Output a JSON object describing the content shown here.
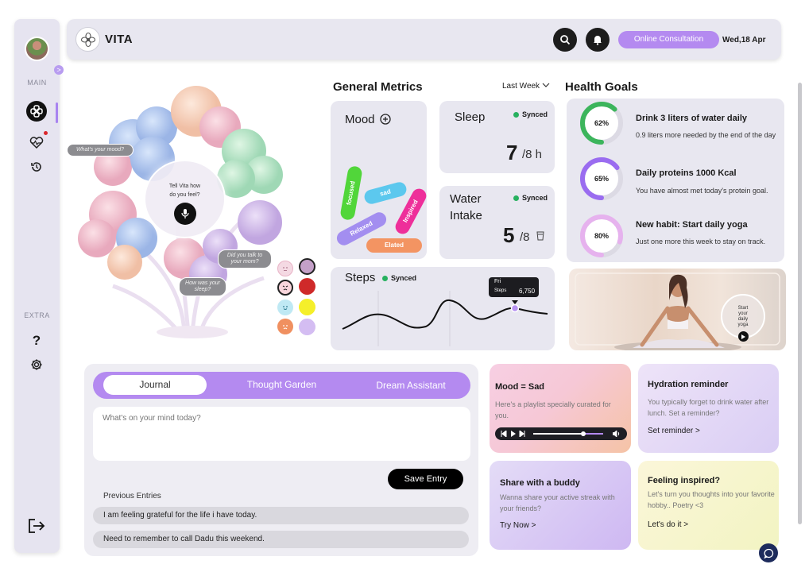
{
  "app": {
    "name": "VITA",
    "date": "Wed,18 Apr",
    "consult_label": "Online Consultation"
  },
  "sidebar": {
    "main_label": "MAIN",
    "extra_label": "EXTRA",
    "expand_icon": ">"
  },
  "hero": {
    "bubble_mood": "What's your mood?",
    "talk_prompt": "Tell Vita how do you feel?",
    "bubble_mom": "Did you talk to your mom?",
    "bubble_sleep": "How was your sleep?"
  },
  "metrics": {
    "title": "General Metrics",
    "period": "Last Week",
    "mood_title": "Mood",
    "mood_tags": [
      "focused",
      "sad",
      "Inspired",
      "Relaxed",
      "Elated"
    ],
    "sleep": {
      "title": "Sleep",
      "status": "Synced",
      "value": "7",
      "unit": "/8 h"
    },
    "water": {
      "title_line1": "Water",
      "title_line2": "Intake",
      "status": "Synced",
      "value": "5",
      "unit": "/8"
    },
    "steps": {
      "title": "Steps",
      "status": "Synced",
      "tooltip_day": "Fri",
      "tooltip_label": "Steps",
      "tooltip_value": "6,750"
    }
  },
  "health_goals": {
    "title": "Health Goals",
    "goals": [
      {
        "percent": "62%",
        "value": 62,
        "title": "Drink 3 liters of water daily",
        "desc": "0.9 liters more needed by the end of the day",
        "color": "#3cb55c"
      },
      {
        "percent": "65%",
        "value": 65,
        "title": "Daily proteins 1000 Kcal",
        "desc": "You have almost met today's protein goal.",
        "color": "#9a6cf0"
      },
      {
        "percent": "80%",
        "value": 80,
        "title": "New habit: Start daily yoga",
        "desc": "Just one more this week to stay on track.",
        "color": "#e6b2ee"
      }
    ],
    "yoga_label": "Start your daily yoga"
  },
  "journal": {
    "tabs": [
      "Journal",
      "Thought Garden",
      "Dream Assistant"
    ],
    "placeholder": "What's on your mind today?",
    "save_label": "Save Entry",
    "previous_title": "Previous Entries",
    "entries": [
      "I am feeling grateful for the life i have today.",
      "Need to remember to call Dadu this weekend."
    ]
  },
  "cards": {
    "mood": {
      "title": "Mood = Sad",
      "desc": "Here's a playlist specially curated for you."
    },
    "hydration": {
      "title": "Hydration reminder",
      "desc": "You typically forget to drink water after lunch. Set a reminder?",
      "link": "Set reminder >"
    },
    "buddy": {
      "title": "Share with a buddy",
      "desc": "Wanna share your active streak with your friends?",
      "link": "Try Now >"
    },
    "inspired": {
      "title": "Feeling inspired?",
      "desc": "Let's turn you thoughts into your favorite hobby.. Poetry <3",
      "link": "Let's do it >"
    }
  }
}
